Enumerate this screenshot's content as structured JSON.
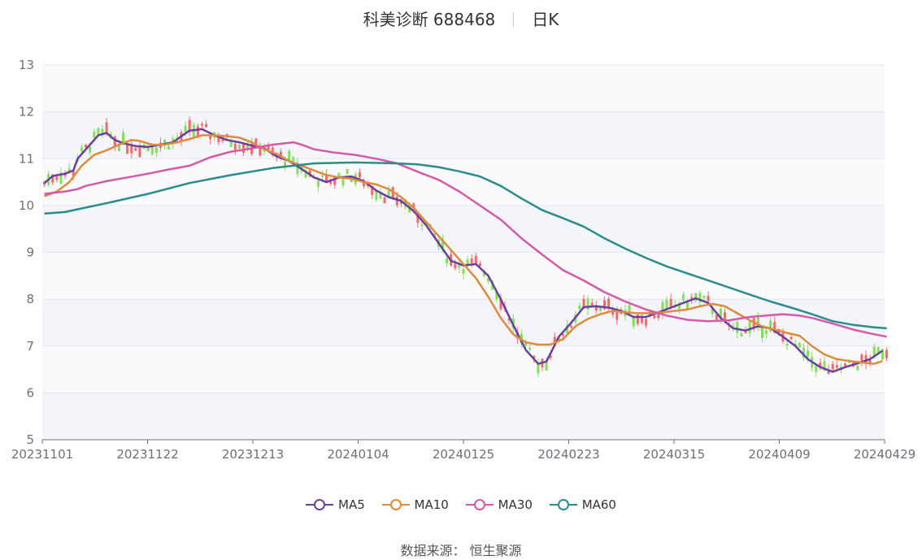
{
  "header": {
    "title": "科美诊断 688468",
    "period": "日K"
  },
  "source": "数据来源： 恒生聚源",
  "chart_data": {
    "type": "candlestick",
    "ylim": [
      5,
      13
    ],
    "yticks": [
      5,
      6,
      7,
      8,
      9,
      10,
      11,
      12,
      13
    ],
    "xtick_labels": [
      "20231101",
      "20231122",
      "20231213",
      "20240104",
      "20240125",
      "20240223",
      "20240315",
      "20240409",
      "20240429"
    ],
    "up_color": "#f26b6b",
    "down_color": "#82e05a",
    "legend": [
      {
        "name": "MA5",
        "color": "#6b3fa0"
      },
      {
        "name": "MA10",
        "color": "#e08a3c"
      },
      {
        "name": "MA30",
        "color": "#d45aa8"
      },
      {
        "name": "MA60",
        "color": "#2a8c8c"
      }
    ],
    "ma": {
      "MA5": [
        [
          0,
          10.48
        ],
        [
          2,
          10.63
        ],
        [
          5,
          10.68
        ],
        [
          7,
          10.75
        ],
        [
          8,
          11.0
        ],
        [
          11,
          11.3
        ],
        [
          13,
          11.5
        ],
        [
          15,
          11.55
        ],
        [
          17,
          11.4
        ],
        [
          19,
          11.33
        ],
        [
          22,
          11.27
        ],
        [
          25,
          11.25
        ],
        [
          28,
          11.3
        ],
        [
          31,
          11.35
        ],
        [
          33,
          11.48
        ],
        [
          35,
          11.6
        ],
        [
          38,
          11.63
        ],
        [
          41,
          11.5
        ],
        [
          44,
          11.4
        ],
        [
          47,
          11.35
        ],
        [
          50,
          11.28
        ],
        [
          53,
          11.22
        ],
        [
          56,
          11.05
        ],
        [
          59,
          10.95
        ],
        [
          62,
          10.78
        ],
        [
          65,
          10.6
        ],
        [
          68,
          10.5
        ],
        [
          71,
          10.6
        ],
        [
          74,
          10.62
        ],
        [
          77,
          10.52
        ],
        [
          80,
          10.32
        ],
        [
          83,
          10.18
        ],
        [
          86,
          10.1
        ],
        [
          89,
          9.88
        ],
        [
          92,
          9.58
        ],
        [
          95,
          9.2
        ],
        [
          98,
          8.82
        ],
        [
          101,
          8.72
        ],
        [
          104,
          8.75
        ],
        [
          107,
          8.5
        ],
        [
          110,
          8.0
        ],
        [
          113,
          7.45
        ],
        [
          116,
          6.92
        ],
        [
          119,
          6.62
        ],
        [
          121,
          6.67
        ],
        [
          124,
          7.2
        ],
        [
          127,
          7.5
        ],
        [
          130,
          7.83
        ],
        [
          133,
          7.85
        ],
        [
          136,
          7.82
        ],
        [
          139,
          7.75
        ],
        [
          142,
          7.62
        ],
        [
          145,
          7.62
        ],
        [
          148,
          7.72
        ],
        [
          151,
          7.82
        ],
        [
          154,
          7.92
        ],
        [
          157,
          8.02
        ],
        [
          160,
          7.92
        ],
        [
          163,
          7.6
        ],
        [
          166,
          7.38
        ],
        [
          169,
          7.33
        ],
        [
          172,
          7.42
        ],
        [
          175,
          7.38
        ],
        [
          178,
          7.2
        ],
        [
          181,
          7.0
        ],
        [
          184,
          6.72
        ],
        [
          187,
          6.55
        ],
        [
          190,
          6.45
        ],
        [
          193,
          6.55
        ],
        [
          196,
          6.63
        ],
        [
          199,
          6.72
        ],
        [
          202,
          6.9
        ]
      ],
      "MA10": [
        [
          0,
          10.2
        ],
        [
          3,
          10.3
        ],
        [
          6,
          10.5
        ],
        [
          9,
          10.85
        ],
        [
          12,
          11.08
        ],
        [
          15,
          11.18
        ],
        [
          18,
          11.3
        ],
        [
          21,
          11.4
        ],
        [
          23,
          11.38
        ],
        [
          26,
          11.3
        ],
        [
          29,
          11.3
        ],
        [
          32,
          11.35
        ],
        [
          35,
          11.42
        ],
        [
          38,
          11.5
        ],
        [
          41,
          11.5
        ],
        [
          44,
          11.48
        ],
        [
          47,
          11.45
        ],
        [
          50,
          11.35
        ],
        [
          53,
          11.2
        ],
        [
          56,
          11.1
        ],
        [
          59,
          10.95
        ],
        [
          62,
          10.85
        ],
        [
          65,
          10.75
        ],
        [
          68,
          10.65
        ],
        [
          71,
          10.6
        ],
        [
          74,
          10.57
        ],
        [
          77,
          10.5
        ],
        [
          80,
          10.45
        ],
        [
          83,
          10.35
        ],
        [
          86,
          10.18
        ],
        [
          89,
          9.95
        ],
        [
          92,
          9.65
        ],
        [
          95,
          9.35
        ],
        [
          98,
          9.05
        ],
        [
          101,
          8.75
        ],
        [
          104,
          8.45
        ],
        [
          107,
          8.05
        ],
        [
          110,
          7.6
        ],
        [
          113,
          7.25
        ],
        [
          116,
          7.08
        ],
        [
          119,
          7.03
        ],
        [
          122,
          7.03
        ],
        [
          125,
          7.15
        ],
        [
          128,
          7.42
        ],
        [
          131,
          7.58
        ],
        [
          134,
          7.68
        ],
        [
          137,
          7.75
        ],
        [
          140,
          7.72
        ],
        [
          143,
          7.7
        ],
        [
          146,
          7.7
        ],
        [
          149,
          7.72
        ],
        [
          152,
          7.75
        ],
        [
          155,
          7.78
        ],
        [
          158,
          7.85
        ],
        [
          161,
          7.9
        ],
        [
          164,
          7.85
        ],
        [
          167,
          7.7
        ],
        [
          170,
          7.55
        ],
        [
          173,
          7.42
        ],
        [
          176,
          7.35
        ],
        [
          179,
          7.28
        ],
        [
          182,
          7.22
        ],
        [
          185,
          7.0
        ],
        [
          188,
          6.82
        ],
        [
          191,
          6.72
        ],
        [
          194,
          6.68
        ],
        [
          197,
          6.65
        ],
        [
          200,
          6.62
        ],
        [
          202,
          6.68
        ]
      ],
      "MA30": [
        [
          0,
          10.25
        ],
        [
          5,
          10.3
        ],
        [
          8,
          10.35
        ],
        [
          10,
          10.42
        ],
        [
          15,
          10.52
        ],
        [
          20,
          10.6
        ],
        [
          25,
          10.68
        ],
        [
          30,
          10.77
        ],
        [
          35,
          10.85
        ],
        [
          40,
          11.03
        ],
        [
          45,
          11.15
        ],
        [
          50,
          11.22
        ],
        [
          55,
          11.3
        ],
        [
          60,
          11.35
        ],
        [
          62,
          11.3
        ],
        [
          65,
          11.2
        ],
        [
          70,
          11.13
        ],
        [
          75,
          11.08
        ],
        [
          80,
          11.0
        ],
        [
          85,
          10.9
        ],
        [
          90,
          10.72
        ],
        [
          95,
          10.55
        ],
        [
          100,
          10.3
        ],
        [
          105,
          10.0
        ],
        [
          110,
          9.7
        ],
        [
          115,
          9.3
        ],
        [
          120,
          8.95
        ],
        [
          125,
          8.62
        ],
        [
          130,
          8.4
        ],
        [
          135,
          8.15
        ],
        [
          140,
          7.95
        ],
        [
          145,
          7.78
        ],
        [
          150,
          7.65
        ],
        [
          155,
          7.56
        ],
        [
          160,
          7.53
        ],
        [
          165,
          7.55
        ],
        [
          170,
          7.62
        ],
        [
          175,
          7.66
        ],
        [
          178,
          7.68
        ],
        [
          182,
          7.65
        ],
        [
          185,
          7.6
        ],
        [
          190,
          7.48
        ],
        [
          195,
          7.35
        ],
        [
          200,
          7.25
        ],
        [
          203,
          7.2
        ]
      ],
      "MA60": [
        [
          0,
          9.83
        ],
        [
          5,
          9.86
        ],
        [
          8,
          9.92
        ],
        [
          15,
          10.05
        ],
        [
          25,
          10.25
        ],
        [
          35,
          10.48
        ],
        [
          45,
          10.65
        ],
        [
          55,
          10.8
        ],
        [
          65,
          10.9
        ],
        [
          75,
          10.92
        ],
        [
          85,
          10.9
        ],
        [
          90,
          10.88
        ],
        [
          95,
          10.82
        ],
        [
          100,
          10.73
        ],
        [
          105,
          10.62
        ],
        [
          110,
          10.42
        ],
        [
          115,
          10.15
        ],
        [
          120,
          9.9
        ],
        [
          125,
          9.73
        ],
        [
          130,
          9.55
        ],
        [
          135,
          9.3
        ],
        [
          140,
          9.08
        ],
        [
          145,
          8.88
        ],
        [
          150,
          8.7
        ],
        [
          155,
          8.55
        ],
        [
          160,
          8.4
        ],
        [
          165,
          8.25
        ],
        [
          170,
          8.1
        ],
        [
          175,
          7.95
        ],
        [
          180,
          7.82
        ],
        [
          185,
          7.68
        ],
        [
          190,
          7.53
        ],
        [
          195,
          7.45
        ],
        [
          200,
          7.4
        ],
        [
          203,
          7.38
        ]
      ]
    }
  }
}
